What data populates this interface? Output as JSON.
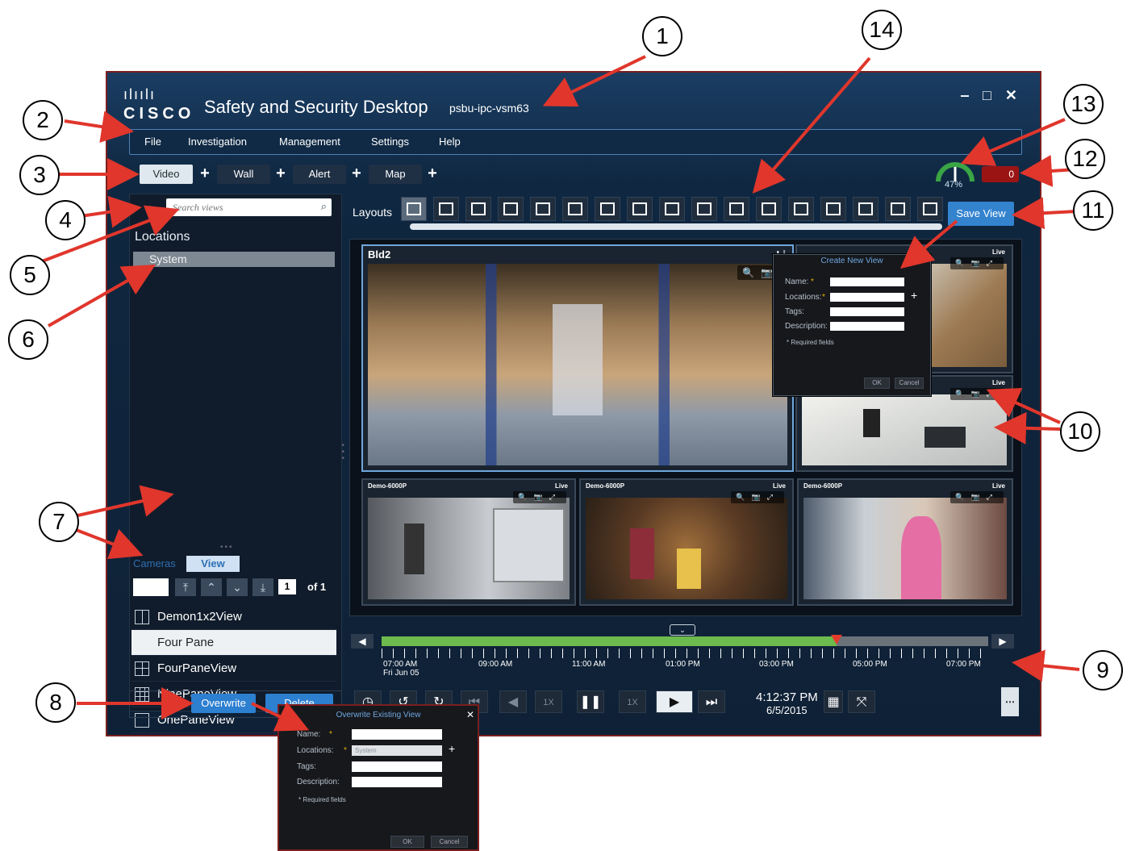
{
  "window": {
    "logo_bars": "ılıılı",
    "logo_text": "CISCO",
    "title": "Safety and Security Desktop",
    "host": "psbu-ipc-vsm63",
    "controls": "‒ □ ✕"
  },
  "menu": [
    "File",
    "Investigation",
    "Management",
    "Settings",
    "Help"
  ],
  "tabs": [
    {
      "label": "Video",
      "active": true
    },
    {
      "label": "Wall",
      "active": false
    },
    {
      "label": "Alert",
      "active": false
    },
    {
      "label": "Map",
      "active": false
    }
  ],
  "plus_glyph": "+",
  "status": {
    "cpu_percent": "47%",
    "cpu_value": 0.47,
    "alarm_count": "0"
  },
  "left_panel": {
    "collapse_glyph": "◄",
    "search_placeholder": "Search views",
    "locations_heading": "Locations",
    "location_selected": "System",
    "subtabs": [
      {
        "label": "Cameras",
        "active": false
      },
      {
        "label": "View",
        "active": true
      }
    ],
    "page_number": "1",
    "page_of": "of 1",
    "views": [
      {
        "label": "Demon1x2View",
        "icon": "two-pane-layout-icon",
        "selected": false
      },
      {
        "label": "Four Pane",
        "icon": "none",
        "selected": true
      },
      {
        "label": "FourPaneView",
        "icon": "four-pane-layout-icon",
        "selected": false
      },
      {
        "label": "NinePaneView",
        "icon": "nine-pane-layout-icon",
        "selected": false
      },
      {
        "label": "OnePaneView",
        "icon": "one-pane-layout-icon",
        "selected": false
      }
    ],
    "overwrite_label": "Overwrite",
    "delete_label": "Delete"
  },
  "layouts": {
    "label": "Layouts",
    "count": 17,
    "save_view_label": "Save View"
  },
  "panes": [
    {
      "title": "Bld2",
      "live": "Li"
    },
    {
      "title": "",
      "live": "Live"
    },
    {
      "title": "",
      "live": "Live"
    },
    {
      "title": "Demo-6000P",
      "live": "Live"
    },
    {
      "title": "Demo-6000P",
      "live": "Live"
    },
    {
      "title": "Demo-6000P",
      "live": "Live"
    }
  ],
  "create_view_dialog": {
    "title": "Create New View",
    "name_label": "Name:",
    "locations_label": "Locations:",
    "tags_label": "Tags:",
    "description_label": "Description:",
    "required_note": "* Required fields",
    "ok_label": "OK",
    "cancel_label": "Cancel"
  },
  "timeline": {
    "position_fraction": 0.75,
    "labels": [
      "07:00 AM",
      "09:00 AM",
      "11:00 AM",
      "01:00 PM",
      "03:00 PM",
      "05:00 PM",
      "07:00 PM"
    ],
    "date_label": "Fri Jun 05"
  },
  "playback": {
    "speed_left": "1X",
    "speed_right": "1X",
    "time": "4:12:37 PM",
    "date": "6/5/2015"
  },
  "overwrite_dialog": {
    "title": "Overwrite Existing View",
    "close": "✕",
    "name_label": "Name:",
    "locations_label": "Locations:",
    "location_value": "System",
    "tags_label": "Tags:",
    "description_label": "Description:",
    "required_note": "* Required fields",
    "ok_label": "OK",
    "cancel_label": "Cancel"
  },
  "callouts": [
    "1",
    "2",
    "3",
    "4",
    "5",
    "6",
    "7",
    "8",
    "9",
    "10",
    "11",
    "12",
    "13",
    "14"
  ],
  "colors": {
    "accent": "#3383cf",
    "callout_arrow": "#e0362c",
    "timeline_fill": "#6dba4e",
    "alarm": "#9b1414"
  }
}
